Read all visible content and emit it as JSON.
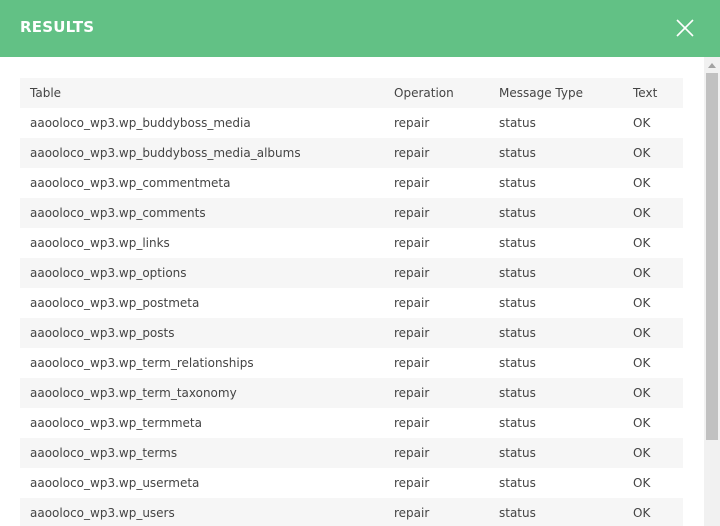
{
  "header": {
    "title": "RESULTS",
    "icon": "close-icon"
  },
  "colors": {
    "header_bg": "#62c185",
    "row_stripe": "#f6f6f6"
  },
  "table": {
    "columns": [
      "Table",
      "Operation",
      "Message Type",
      "Text"
    ],
    "rows": [
      [
        "aaooloco_wp3.wp_buddyboss_media",
        "repair",
        "status",
        "OK"
      ],
      [
        "aaooloco_wp3.wp_buddyboss_media_albums",
        "repair",
        "status",
        "OK"
      ],
      [
        "aaooloco_wp3.wp_commentmeta",
        "repair",
        "status",
        "OK"
      ],
      [
        "aaooloco_wp3.wp_comments",
        "repair",
        "status",
        "OK"
      ],
      [
        "aaooloco_wp3.wp_links",
        "repair",
        "status",
        "OK"
      ],
      [
        "aaooloco_wp3.wp_options",
        "repair",
        "status",
        "OK"
      ],
      [
        "aaooloco_wp3.wp_postmeta",
        "repair",
        "status",
        "OK"
      ],
      [
        "aaooloco_wp3.wp_posts",
        "repair",
        "status",
        "OK"
      ],
      [
        "aaooloco_wp3.wp_term_relationships",
        "repair",
        "status",
        "OK"
      ],
      [
        "aaooloco_wp3.wp_term_taxonomy",
        "repair",
        "status",
        "OK"
      ],
      [
        "aaooloco_wp3.wp_termmeta",
        "repair",
        "status",
        "OK"
      ],
      [
        "aaooloco_wp3.wp_terms",
        "repair",
        "status",
        "OK"
      ],
      [
        "aaooloco_wp3.wp_usermeta",
        "repair",
        "status",
        "OK"
      ],
      [
        "aaooloco_wp3.wp_users",
        "repair",
        "status",
        "OK"
      ]
    ]
  }
}
